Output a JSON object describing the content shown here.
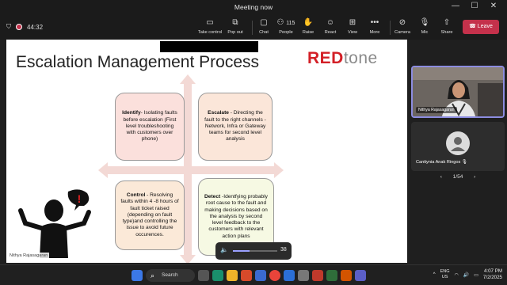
{
  "window": {
    "title": "Meeting now",
    "minimize": "—",
    "maximize": "☐",
    "close": "✕"
  },
  "toolbar": {
    "shield": "⛉",
    "timer": "44:32",
    "take_control": "Take control",
    "pop_out": "Pop out",
    "chat": "Chat",
    "people": "People",
    "people_count": "115",
    "raise": "Raise",
    "react": "React",
    "view": "View",
    "more": "More",
    "camera": "Camera",
    "mic": "Mic",
    "share": "Share",
    "leave": "Leave",
    "leave_color": "#c4314b"
  },
  "slide": {
    "title": "Escalation Management Process",
    "logo_red": "RED",
    "logo_gray": "tone",
    "quadrants": [
      {
        "heading": "Identify",
        "text": "- Isolating faults before escalation (First level troubleshooting with customers over phone)"
      },
      {
        "heading": "Escalate",
        "text": " - Directing the fault to the right channels - Network, Infra or Gateway teams for second level analysis"
      },
      {
        "heading": "Control",
        "text": " - Resolving faults within 4 -8 hours of fault ticket raised (depending on fault type)and controlling the issue to avoid future occurences."
      },
      {
        "heading": "Detect",
        "text": " -Identfying probably root cause to the fault and making decisions based on the analysis by second level feedback to the customers with relevant action plans"
      }
    ],
    "presenter_tag": "Nithya Rajasagaran"
  },
  "volume": {
    "level": 38,
    "value": "38"
  },
  "participants": [
    {
      "name": "Nithya Rajasagaran",
      "video": true
    },
    {
      "name": "Cantiynia Anak Ringos",
      "video": false
    }
  ],
  "pager": {
    "prev": "‹",
    "label": "1/54",
    "next": "›"
  },
  "taskbar": {
    "search": "Search",
    "lang_top": "ENG",
    "lang_bottom": "US",
    "time": "4:07 PM",
    "date": "7/2/2025"
  }
}
